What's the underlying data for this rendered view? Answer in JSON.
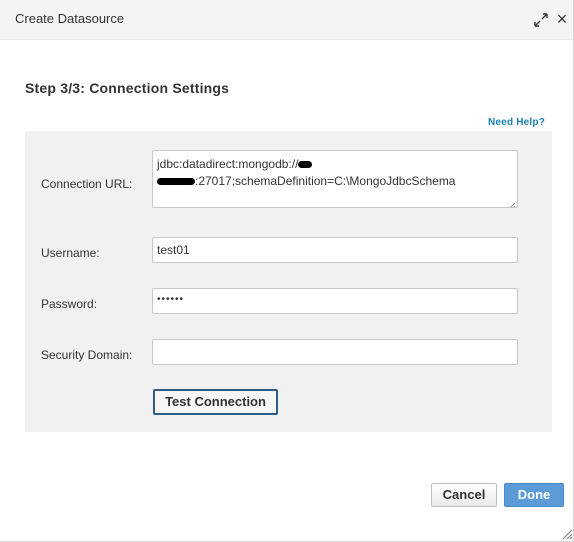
{
  "dialog": {
    "title": "Create Datasource",
    "maximize_icon": "expand-arrows-icon",
    "close_icon": "close-icon",
    "close_glyph": "×"
  },
  "step": {
    "title": "Step 3/3: Connection Settings"
  },
  "help": {
    "label": "Need Help?"
  },
  "form": {
    "connection_url": {
      "label": "Connection URL:",
      "line1": "jdbc:datadirect:mongodb://",
      "line2": ":27017;schemaDefinition=C:\\MongoJdbcSchema"
    },
    "username": {
      "label": "Username:",
      "value": "test01"
    },
    "password": {
      "label": "Password:",
      "value": "••••••"
    },
    "security_domain": {
      "label": "Security Domain:",
      "value": ""
    },
    "test_button": "Test Connection"
  },
  "footer": {
    "cancel_label": "Cancel",
    "done_label": "Done"
  },
  "colors": {
    "accent": "#5a9bd8",
    "link": "#1a7fb5",
    "panel": "#f1f1f1"
  }
}
